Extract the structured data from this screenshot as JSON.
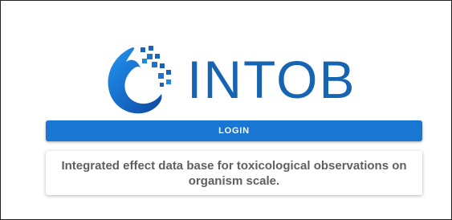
{
  "logo": {
    "text": "INTOB",
    "icon": "intob-logo-icon",
    "color": "#1665b3"
  },
  "login_button": {
    "label": "LOGIN",
    "color": "#1976d2"
  },
  "description": {
    "text": "Integrated effect data base for toxicological observations on organism scale."
  }
}
